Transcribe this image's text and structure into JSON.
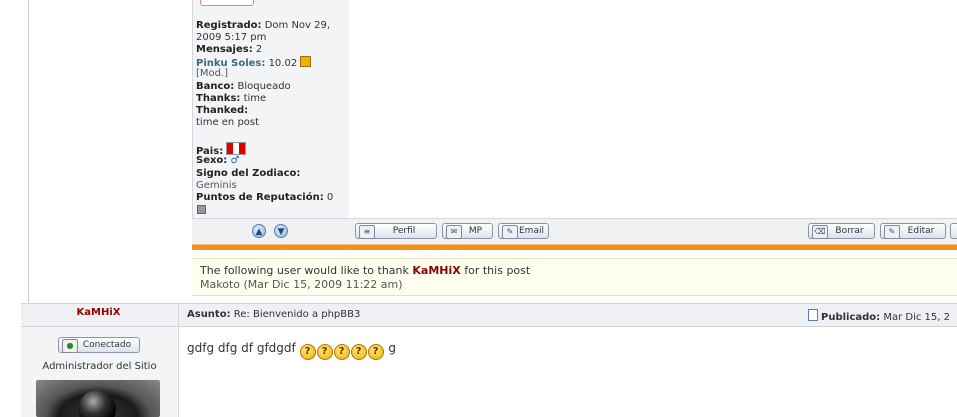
{
  "post1": {
    "profile": {
      "registered_label": "Registrado:",
      "registered_value_1": "Dom Nov 29,",
      "registered_value_2": "2009 5:17 pm",
      "messages_label": "Mensajes:",
      "messages_value": "2",
      "pinku_label": "Pinku Soles:",
      "pinku_value": "10.02",
      "mod_link": "[Mod.]",
      "bank_label": "Banco:",
      "bank_value": "Bloqueado",
      "thanks_label": "Thanks:",
      "thanks_value": "time",
      "thanked_label": "Thanked:",
      "thanked_value": "time en post",
      "country_label": "Pais:",
      "sex_label": "Sexo:",
      "zodiac_label": "Signo del Zodiaco:",
      "zodiac_value": "Geminis",
      "reputation_label": "Puntos de Reputación:",
      "reputation_value": "0"
    },
    "actions": {
      "profile_btn": "Perfil",
      "pm_btn": "MP",
      "email_btn": "Email",
      "delete_btn": "Borrar",
      "edit_btn": "Editar"
    },
    "thanks": {
      "text_before": "The following user would like to thank",
      "thanked_user": "KaMHiX",
      "text_after": "for this post",
      "thanker": "Makoto",
      "thanker_date": "(Mar Dic 15, 2009 11:22 am)"
    }
  },
  "post2": {
    "author": "KaMHiX",
    "subject_label": "Asunto:",
    "subject_value": "Re: Bienvenido a phpBB3",
    "posted_label": "Publicado:",
    "posted_value": "Mar Dic 15, 2",
    "status_btn": "Conectado",
    "role": "Administrador del Sitio",
    "message_text": "gdfg dfg df gfdgdf",
    "message_tail": "g",
    "smiley_count": 5
  },
  "colors": {
    "accent_orange": "#f0901e",
    "author_red": "#a00000",
    "thanks_bg": "#fffff0"
  }
}
